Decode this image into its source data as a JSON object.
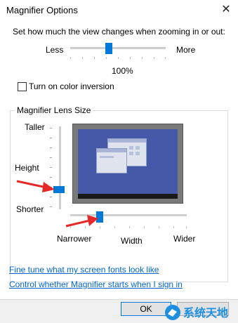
{
  "window": {
    "title": "Magnifier Options"
  },
  "zoom": {
    "prompt": "Set how much the view changes when zooming in or out:",
    "min_label": "Less",
    "max_label": "More",
    "value_label": "100%",
    "slider_fraction": 0.4
  },
  "color_inversion": {
    "label": "Turn on color inversion",
    "checked": false
  },
  "lens_size": {
    "legend": "Magnifier Lens Size",
    "height": {
      "top_label": "Taller",
      "axis_label": "Height",
      "bottom_label": "Shorter",
      "fraction_from_top": 0.75
    },
    "width": {
      "left_label": "Narrower",
      "axis_label": "Width",
      "right_label": "Wider",
      "fraction": 0.25
    }
  },
  "links": [
    {
      "label": "Fine tune what my screen fonts look like"
    },
    {
      "label": "Control whether Magnifier starts when I sign in"
    }
  ],
  "buttons": {
    "ok": "OK"
  },
  "colors": {
    "accent": "#0078d7",
    "arrow": "#e62828",
    "link": "#0066cc",
    "preview_screen": "#4658a8"
  },
  "watermark": {
    "text": "系统天地"
  }
}
